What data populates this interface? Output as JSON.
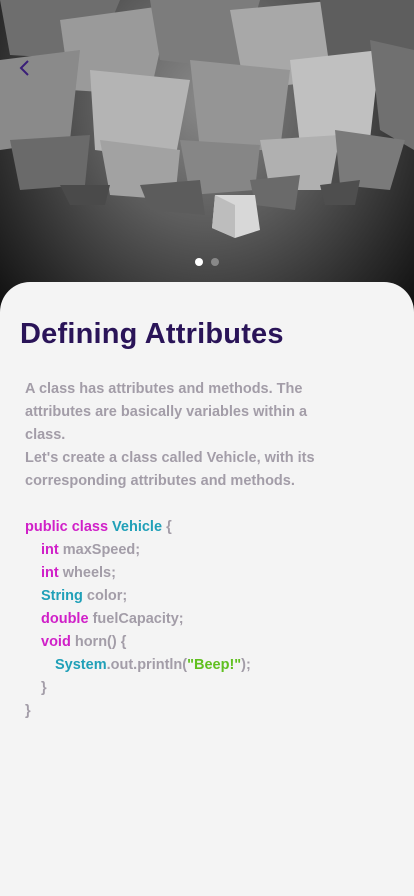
{
  "hero": {
    "slide_count": 2,
    "active_slide": 1
  },
  "nav": {
    "back_icon": "chevron-left-icon"
  },
  "lesson": {
    "title": "Defining Attributes",
    "paragraphs": [
      "A class has attributes and methods. The attributes are basically variables within a class.",
      "Let's create a class called Vehicle, with its corresponding attributes and methods."
    ]
  },
  "code": {
    "l1": {
      "kw": "public class",
      "cls": "Vehicle",
      "rest": "{"
    },
    "l2": {
      "kw": "int",
      "rest": "maxSpeed;"
    },
    "l3": {
      "kw": "int",
      "rest": "wheels;"
    },
    "l4": {
      "ty": "String",
      "rest": "color;"
    },
    "l5": {
      "kw": "double",
      "rest": "fuelCapacity;"
    },
    "l6": {
      "kw": "void",
      "rest": "horn() {"
    },
    "l7": {
      "ty": "System",
      "mid": ".out.println(",
      "str": "\"Beep!\"",
      "end": ");"
    },
    "l8": "}",
    "l9": "}"
  },
  "colors": {
    "title": "#2a1458",
    "text": "#a39da8",
    "keyword": "#d020c8",
    "type": "#20a0b8",
    "string": "#60c020"
  }
}
